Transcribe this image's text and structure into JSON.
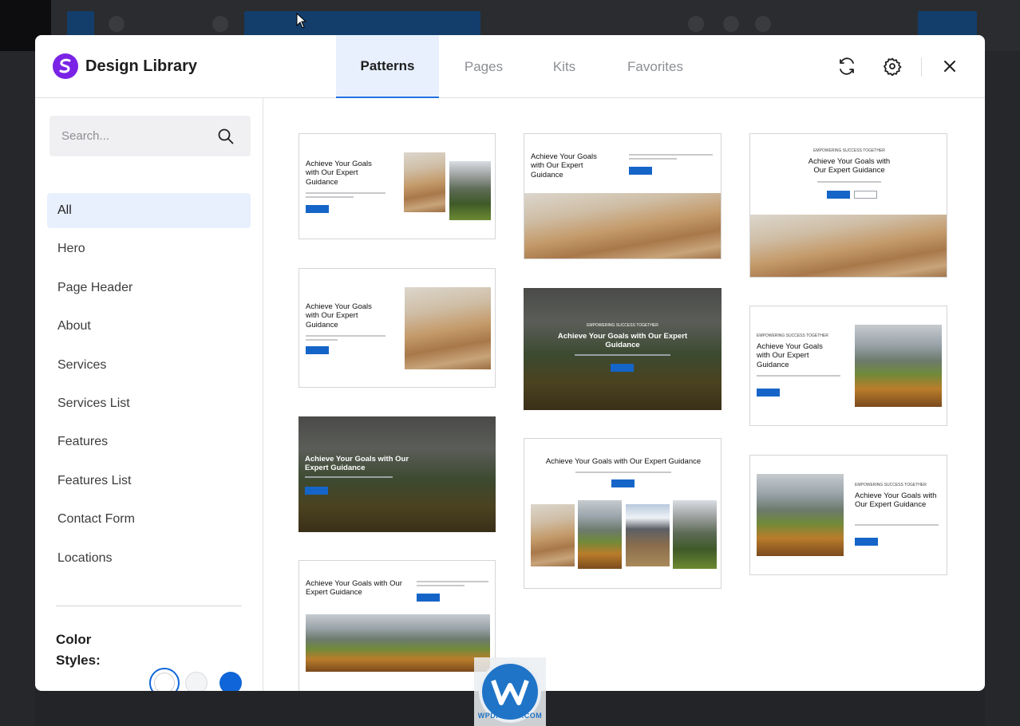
{
  "app": {
    "title": "Design Library"
  },
  "tabs": [
    {
      "label": "Patterns",
      "active": true
    },
    {
      "label": "Pages",
      "active": false
    },
    {
      "label": "Kits",
      "active": false
    },
    {
      "label": "Favorites",
      "active": false
    }
  ],
  "header_icons": [
    "refresh-icon",
    "settings-icon",
    "close-icon"
  ],
  "search": {
    "placeholder": "Search...",
    "value": ""
  },
  "categories": [
    {
      "label": "All",
      "active": true
    },
    {
      "label": "Hero",
      "active": false
    },
    {
      "label": "Page Header",
      "active": false
    },
    {
      "label": "About",
      "active": false
    },
    {
      "label": "Services",
      "active": false
    },
    {
      "label": "Services List",
      "active": false
    },
    {
      "label": "Features",
      "active": false
    },
    {
      "label": "Features List",
      "active": false
    },
    {
      "label": "Contact Form",
      "active": false
    },
    {
      "label": "Locations",
      "active": false
    }
  ],
  "color_styles": {
    "label": "Color Styles:",
    "options": [
      {
        "name": "white",
        "color": "#ffffff",
        "selected": true
      },
      {
        "name": "light-gray",
        "color": "#f3f4f6",
        "selected": false
      },
      {
        "name": "blue",
        "color": "#1066d8",
        "selected": false
      }
    ]
  },
  "patterns": {
    "heading_short": "Achieve Your Goals with Our Expert Guidance",
    "kicker": "EMPOWERING SUCCESS TOGETHER"
  },
  "colors": {
    "accent": "#2271e1",
    "brand": "#7a23e6",
    "button": "#1565c8"
  },
  "watermark": {
    "text": "WPDISTRIB.COM"
  }
}
